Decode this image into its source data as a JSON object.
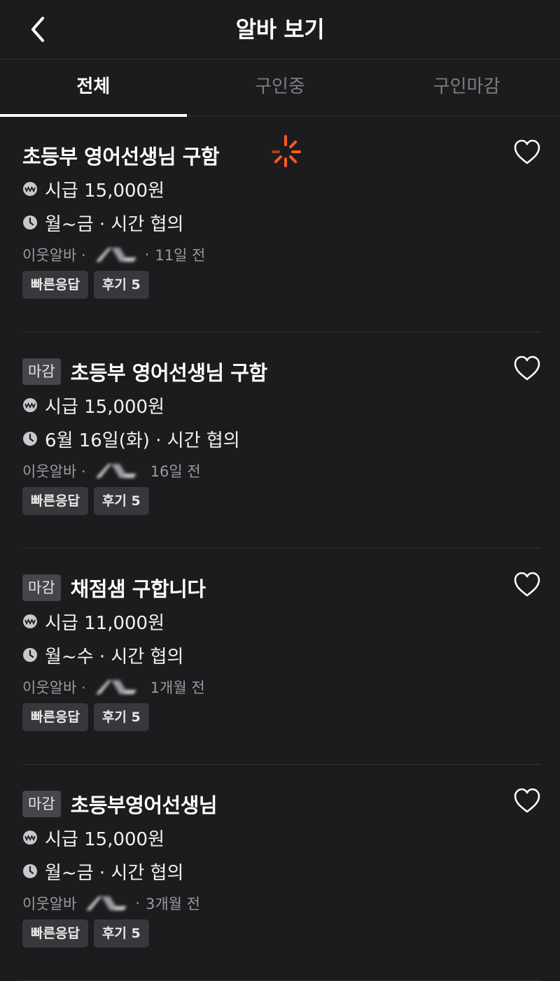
{
  "header": {
    "title": "알바 보기"
  },
  "tabs": [
    {
      "label": "전체",
      "active": true
    },
    {
      "label": "구인중",
      "active": false
    },
    {
      "label": "구인마감",
      "active": false
    }
  ],
  "items": [
    {
      "badge": "",
      "title": "초등부 영어선생님 구함",
      "pay": "시급 15,000원",
      "schedule": "월~금 · 시간 협의",
      "source": "이웃알바 ·",
      "sep2": "·",
      "posted": "11일 전",
      "tags": [
        "빠른응답",
        "후기 5"
      ]
    },
    {
      "badge": "마감",
      "title": "초등부 영어선생님 구함",
      "pay": "시급 15,000원",
      "schedule": "6월 16일(화) · 시간 협의",
      "source": "이웃알바 ·",
      "sep2": "",
      "posted": "16일 전",
      "tags": [
        "빠른응답",
        "후기 5"
      ]
    },
    {
      "badge": "마감",
      "title": "채점샘 구합니다",
      "pay": "시급 11,000원",
      "schedule": "월~수 · 시간 협의",
      "source": "이웃알바 ·",
      "sep2": "",
      "posted": "1개월 전",
      "tags": [
        "빠른응답",
        "후기 5"
      ]
    },
    {
      "badge": "마감",
      "title": "초등부영어선생님",
      "pay": "시급 15,000원",
      "schedule": "월~금 · 시간 협의",
      "source": "이웃알바",
      "sep2": "·",
      "posted": "3개월 전",
      "tags": [
        "빠른응답",
        "후기 5"
      ]
    }
  ],
  "icons": {
    "back": "chevron-left-icon",
    "favorite": "heart-outline-icon",
    "pay": "won-coin-icon",
    "schedule": "clock-icon",
    "loading": "loading-spinner-icon"
  },
  "colors": {
    "background": "#1c1c1e",
    "spinner": "#ff5a1f",
    "badge": "#45454a",
    "chip": "#38383c"
  }
}
